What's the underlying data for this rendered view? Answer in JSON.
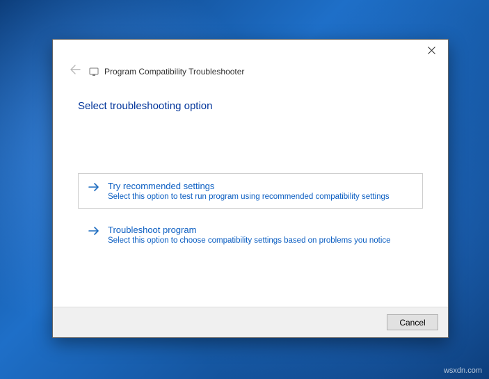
{
  "window": {
    "title": "Program Compatibility Troubleshooter"
  },
  "heading": "Select troubleshooting option",
  "options": [
    {
      "title": "Try recommended settings",
      "description": "Select this option to test run program using recommended compatibility settings"
    },
    {
      "title": "Troubleshoot program",
      "description": "Select this option to choose compatibility settings based on problems you notice"
    }
  ],
  "footer": {
    "cancel_label": "Cancel"
  },
  "watermark": "wsxdn.com"
}
